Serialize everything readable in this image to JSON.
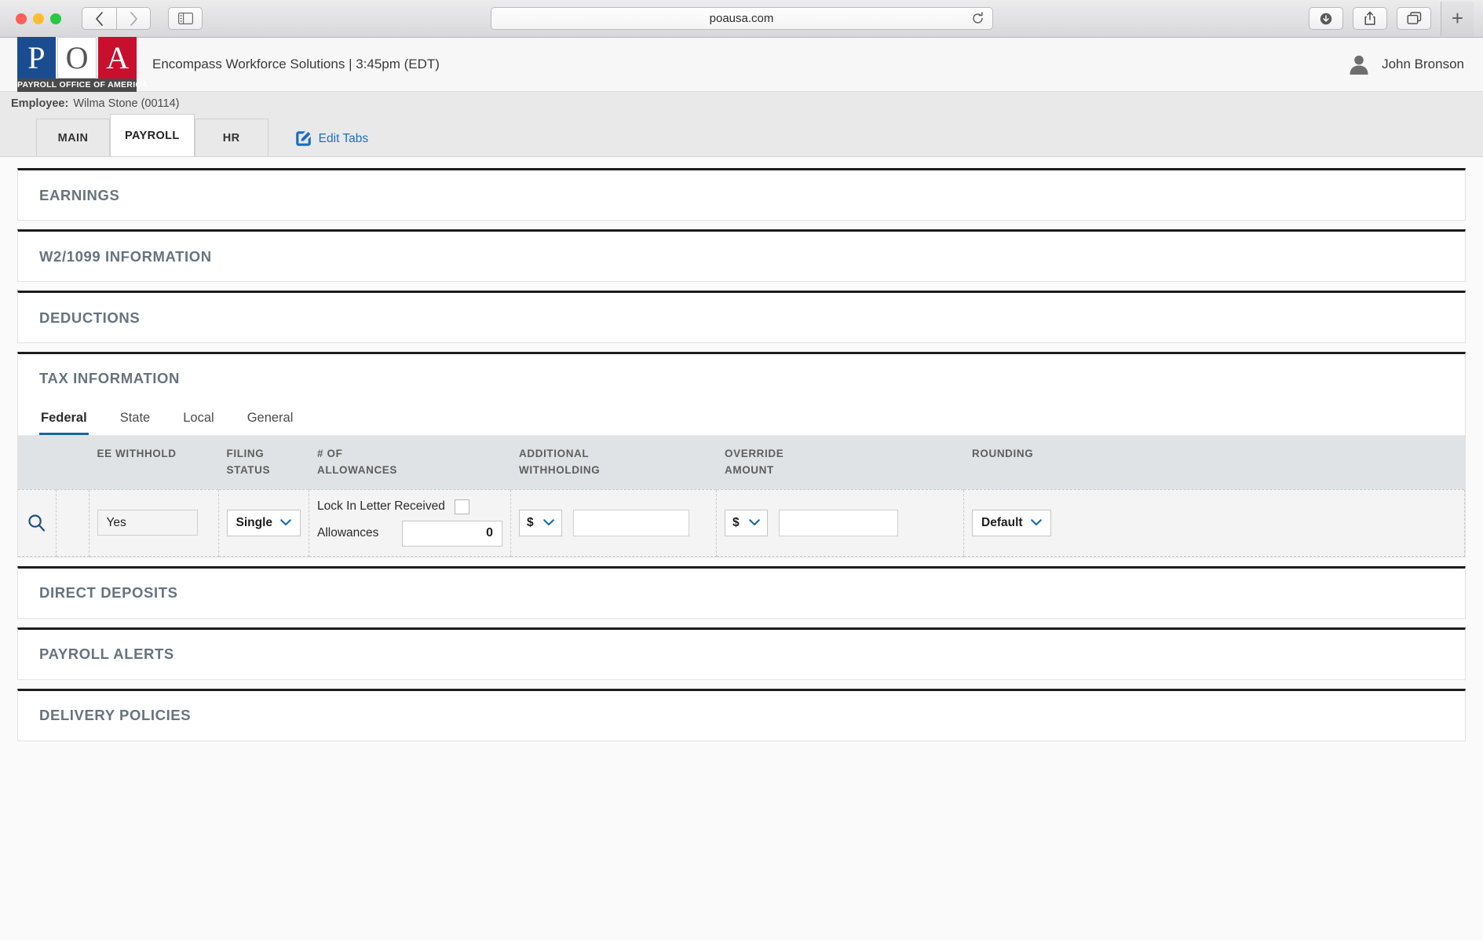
{
  "browser": {
    "url": "poausa.com",
    "back_icon": "chevron-left-icon",
    "forward_icon": "chevron-right-icon",
    "sidebar_icon": "sidebar-icon",
    "reload_icon": "reload-icon",
    "download_icon": "download-icon",
    "share_icon": "share-icon",
    "tabs_icon": "tab-overview-icon",
    "new_tab_label": "+"
  },
  "header": {
    "logo": {
      "p": "P",
      "o": "O",
      "a": "A",
      "subtitle": "PAYROLL OFFICE OF AMERICA"
    },
    "title": "Encompass Workforce Solutions | 3:45pm (EDT)",
    "user_name": "John Bronson",
    "avatar_icon": "user-avatar-icon"
  },
  "employee_bar": {
    "label": "Employee:",
    "value": "Wilma Stone (00114)"
  },
  "tabs": {
    "items": [
      {
        "label": "MAIN",
        "active": false
      },
      {
        "label": "PAYROLL",
        "active": true
      },
      {
        "label": "HR",
        "active": false
      }
    ],
    "edit_tabs_label": "Edit Tabs",
    "edit_tabs_icon": "edit-pencil-icon"
  },
  "sections": [
    {
      "title": "EARNINGS"
    },
    {
      "title": "W2/1099 INFORMATION"
    },
    {
      "title": "DEDUCTIONS"
    }
  ],
  "tax_section": {
    "title": "TAX INFORMATION",
    "subtabs": [
      {
        "label": "Federal",
        "active": true
      },
      {
        "label": "State",
        "active": false
      },
      {
        "label": "Local",
        "active": false
      },
      {
        "label": "General",
        "active": false
      }
    ],
    "columns": [
      "EE WITHHOLD",
      "FILING\nSTATUS",
      "# OF\nALLOWANCES",
      "ADDITIONAL\nWITHHOLDING",
      "OVERRIDE\nAMOUNT",
      "ROUNDING"
    ],
    "row": {
      "search_icon": "search-icon",
      "ee_withhold": "Yes",
      "filing_status": "Single",
      "lock_in_letter_label": "Lock In Letter Received",
      "lock_in_letter_checked": false,
      "allowances_label": "Allowances",
      "allowances_value": "0",
      "additional_withholding_unit": "$",
      "additional_withholding_value": "",
      "override_amount_unit": "$",
      "override_amount_value": "",
      "rounding": "Default"
    }
  },
  "bottom_sections": [
    {
      "title": "DIRECT DEPOSITS"
    },
    {
      "title": "PAYROLL ALERTS"
    },
    {
      "title": "DELIVERY POLICIES"
    }
  ],
  "colors": {
    "section_title": "#67737f",
    "accent_blue": "#1565a8",
    "logo_blue": "#1a4d8f",
    "logo_red": "#c8102e"
  }
}
